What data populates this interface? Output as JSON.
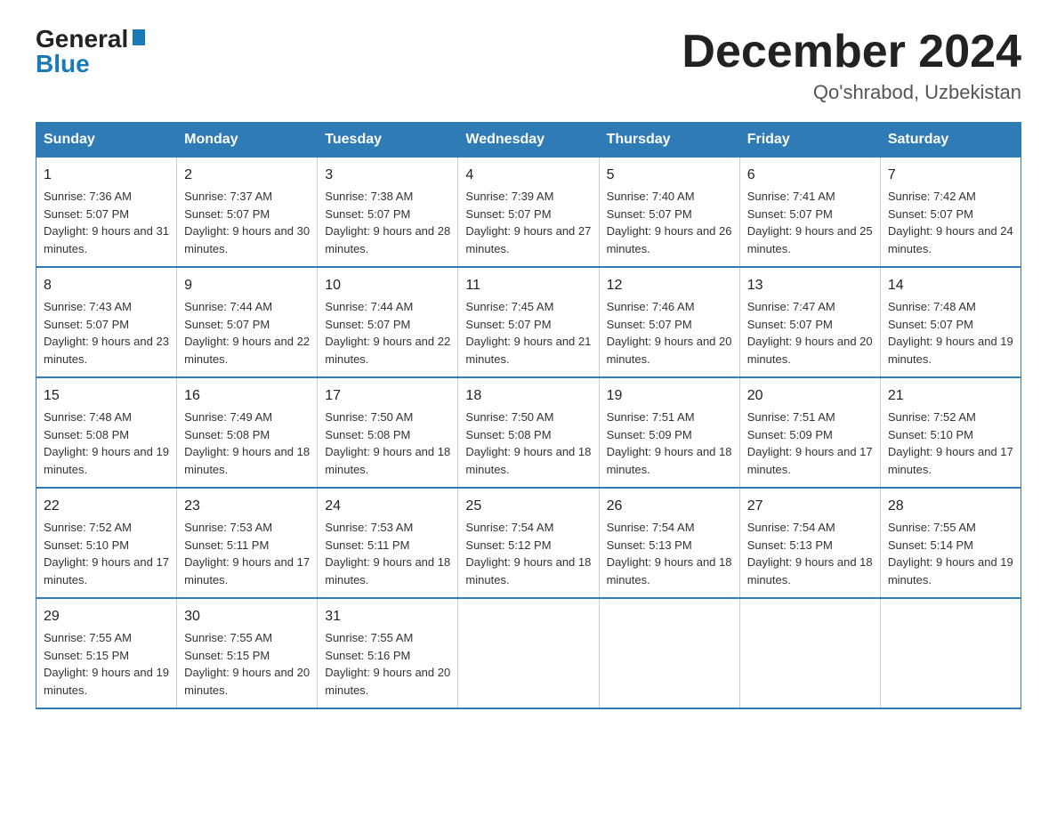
{
  "logo": {
    "general": "General",
    "blue": "Blue"
  },
  "header": {
    "title": "December 2024",
    "location": "Qo'shrabod, Uzbekistan"
  },
  "days_of_week": [
    "Sunday",
    "Monday",
    "Tuesday",
    "Wednesday",
    "Thursday",
    "Friday",
    "Saturday"
  ],
  "weeks": [
    [
      {
        "day": "1",
        "sunrise": "7:36 AM",
        "sunset": "5:07 PM",
        "daylight": "9 hours and 31 minutes."
      },
      {
        "day": "2",
        "sunrise": "7:37 AM",
        "sunset": "5:07 PM",
        "daylight": "9 hours and 30 minutes."
      },
      {
        "day": "3",
        "sunrise": "7:38 AM",
        "sunset": "5:07 PM",
        "daylight": "9 hours and 28 minutes."
      },
      {
        "day": "4",
        "sunrise": "7:39 AM",
        "sunset": "5:07 PM",
        "daylight": "9 hours and 27 minutes."
      },
      {
        "day": "5",
        "sunrise": "7:40 AM",
        "sunset": "5:07 PM",
        "daylight": "9 hours and 26 minutes."
      },
      {
        "day": "6",
        "sunrise": "7:41 AM",
        "sunset": "5:07 PM",
        "daylight": "9 hours and 25 minutes."
      },
      {
        "day": "7",
        "sunrise": "7:42 AM",
        "sunset": "5:07 PM",
        "daylight": "9 hours and 24 minutes."
      }
    ],
    [
      {
        "day": "8",
        "sunrise": "7:43 AM",
        "sunset": "5:07 PM",
        "daylight": "9 hours and 23 minutes."
      },
      {
        "day": "9",
        "sunrise": "7:44 AM",
        "sunset": "5:07 PM",
        "daylight": "9 hours and 22 minutes."
      },
      {
        "day": "10",
        "sunrise": "7:44 AM",
        "sunset": "5:07 PM",
        "daylight": "9 hours and 22 minutes."
      },
      {
        "day": "11",
        "sunrise": "7:45 AM",
        "sunset": "5:07 PM",
        "daylight": "9 hours and 21 minutes."
      },
      {
        "day": "12",
        "sunrise": "7:46 AM",
        "sunset": "5:07 PM",
        "daylight": "9 hours and 20 minutes."
      },
      {
        "day": "13",
        "sunrise": "7:47 AM",
        "sunset": "5:07 PM",
        "daylight": "9 hours and 20 minutes."
      },
      {
        "day": "14",
        "sunrise": "7:48 AM",
        "sunset": "5:07 PM",
        "daylight": "9 hours and 19 minutes."
      }
    ],
    [
      {
        "day": "15",
        "sunrise": "7:48 AM",
        "sunset": "5:08 PM",
        "daylight": "9 hours and 19 minutes."
      },
      {
        "day": "16",
        "sunrise": "7:49 AM",
        "sunset": "5:08 PM",
        "daylight": "9 hours and 18 minutes."
      },
      {
        "day": "17",
        "sunrise": "7:50 AM",
        "sunset": "5:08 PM",
        "daylight": "9 hours and 18 minutes."
      },
      {
        "day": "18",
        "sunrise": "7:50 AM",
        "sunset": "5:08 PM",
        "daylight": "9 hours and 18 minutes."
      },
      {
        "day": "19",
        "sunrise": "7:51 AM",
        "sunset": "5:09 PM",
        "daylight": "9 hours and 18 minutes."
      },
      {
        "day": "20",
        "sunrise": "7:51 AM",
        "sunset": "5:09 PM",
        "daylight": "9 hours and 17 minutes."
      },
      {
        "day": "21",
        "sunrise": "7:52 AM",
        "sunset": "5:10 PM",
        "daylight": "9 hours and 17 minutes."
      }
    ],
    [
      {
        "day": "22",
        "sunrise": "7:52 AM",
        "sunset": "5:10 PM",
        "daylight": "9 hours and 17 minutes."
      },
      {
        "day": "23",
        "sunrise": "7:53 AM",
        "sunset": "5:11 PM",
        "daylight": "9 hours and 17 minutes."
      },
      {
        "day": "24",
        "sunrise": "7:53 AM",
        "sunset": "5:11 PM",
        "daylight": "9 hours and 18 minutes."
      },
      {
        "day": "25",
        "sunrise": "7:54 AM",
        "sunset": "5:12 PM",
        "daylight": "9 hours and 18 minutes."
      },
      {
        "day": "26",
        "sunrise": "7:54 AM",
        "sunset": "5:13 PM",
        "daylight": "9 hours and 18 minutes."
      },
      {
        "day": "27",
        "sunrise": "7:54 AM",
        "sunset": "5:13 PM",
        "daylight": "9 hours and 18 minutes."
      },
      {
        "day": "28",
        "sunrise": "7:55 AM",
        "sunset": "5:14 PM",
        "daylight": "9 hours and 19 minutes."
      }
    ],
    [
      {
        "day": "29",
        "sunrise": "7:55 AM",
        "sunset": "5:15 PM",
        "daylight": "9 hours and 19 minutes."
      },
      {
        "day": "30",
        "sunrise": "7:55 AM",
        "sunset": "5:15 PM",
        "daylight": "9 hours and 20 minutes."
      },
      {
        "day": "31",
        "sunrise": "7:55 AM",
        "sunset": "5:16 PM",
        "daylight": "9 hours and 20 minutes."
      },
      null,
      null,
      null,
      null
    ]
  ]
}
